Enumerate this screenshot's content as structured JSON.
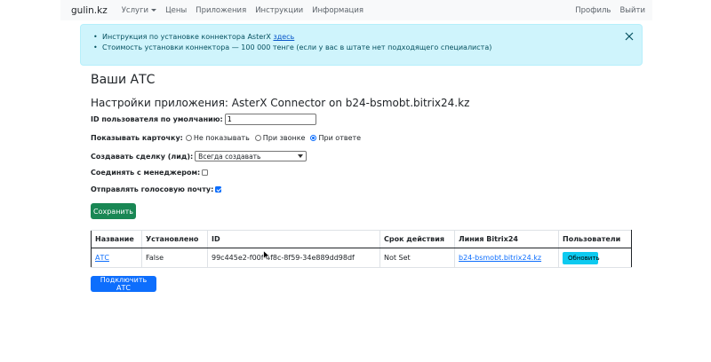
{
  "navbar": {
    "brand": "gulin.kz",
    "links": [
      "Услуги",
      "Цены",
      "Приложения",
      "Инструкции",
      "Информация"
    ],
    "right_links": [
      "Профиль",
      "Выйти"
    ]
  },
  "alert": {
    "item1_text": "Инструкция по установке коннектора AsterX ",
    "item1_link": "здесь",
    "item2_text": "Стоимость установки коннектора — 100 000 тенге (если у вас в штате нет подходящего специалиста)"
  },
  "page_title": "Ваши АТС",
  "section_title": "Настройки приложения: AsterX Connector on b24-bsmobt.bitrix24.kz",
  "form": {
    "user_id_label": "ID пользователя по умолчанию:",
    "user_id_value": "1",
    "show_card_label": "Показывать карточку:",
    "show_card_options": [
      "Не показывать",
      "При звонке",
      "При ответе"
    ],
    "show_card_selected": "При ответе",
    "create_deal_label": "Создавать сделку (лид):",
    "create_deal_value": "Всегда создавать",
    "connect_manager_label": "Соединять с менеджером:",
    "connect_manager_checked": false,
    "send_voicemail_label": "Отправлять голосовую почту:",
    "send_voicemail_checked": true,
    "save_label": "Сохранить"
  },
  "table": {
    "headers": [
      "Название",
      "Установлено",
      "ID",
      "Срок действия",
      "Линия Bitrix24",
      "Пользователи"
    ],
    "rows": [
      {
        "name": "АТС",
        "installed": "False",
        "id": "99c445e2-f00f-4f8c-8f59-34e889dd98df",
        "expiry": "Not Set",
        "line": "b24-bsmobt.bitrix24.kz",
        "users_button": "Обновить"
      }
    ]
  },
  "connect_button": "Подключить АТС",
  "colors": {
    "navbar_bg": "#f8f9fa",
    "alert_bg": "#cff4fc",
    "success": "#198754",
    "primary": "#0d6efd",
    "info": "#0dcaf0"
  }
}
